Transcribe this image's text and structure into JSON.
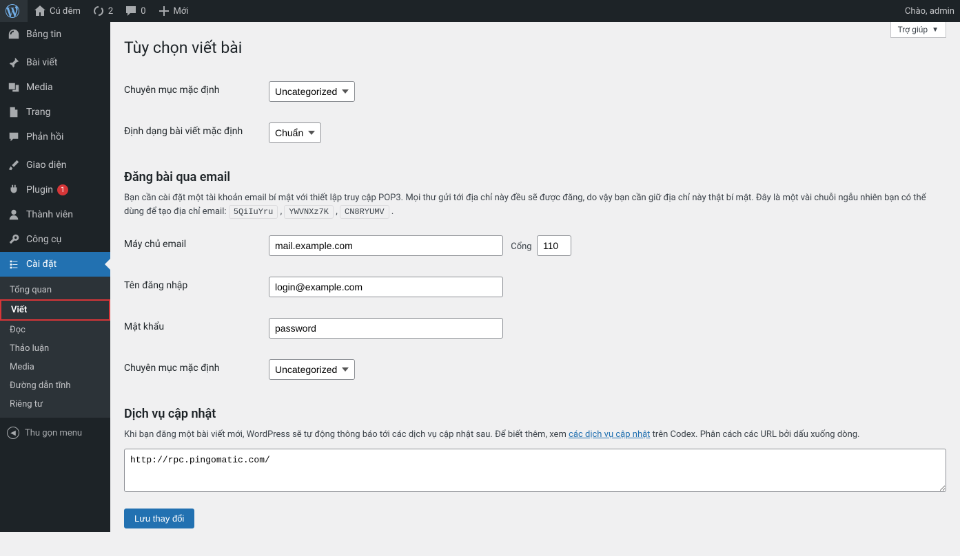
{
  "adminbar": {
    "site_name": "Cú đêm",
    "updates_count": "2",
    "comments_count": "0",
    "new_label": "Mới",
    "greeting": "Chào, admin"
  },
  "sidebar": {
    "items": [
      {
        "label": "Bảng tin",
        "icon": "dashboard"
      },
      {
        "label": "Bài viết",
        "icon": "pin"
      },
      {
        "label": "Media",
        "icon": "media"
      },
      {
        "label": "Trang",
        "icon": "page"
      },
      {
        "label": "Phản hồi",
        "icon": "comment"
      },
      {
        "label": "Giao diện",
        "icon": "brush"
      },
      {
        "label": "Plugin",
        "icon": "plug",
        "badge": "1"
      },
      {
        "label": "Thành viên",
        "icon": "user"
      },
      {
        "label": "Công cụ",
        "icon": "wrench"
      },
      {
        "label": "Cài đặt",
        "icon": "settings",
        "current": true
      }
    ],
    "submenu": [
      {
        "label": "Tổng quan"
      },
      {
        "label": "Viết",
        "current": true
      },
      {
        "label": "Đọc"
      },
      {
        "label": "Thảo luận"
      },
      {
        "label": "Media"
      },
      {
        "label": "Đường dẫn tĩnh"
      },
      {
        "label": "Riêng tư"
      }
    ],
    "collapse_label": "Thu gọn menu"
  },
  "help_tab": "Trợ giúp",
  "page": {
    "title": "Tùy chọn viết bài",
    "default_category_label": "Chuyên mục mặc định",
    "default_category_value": "Uncategorized",
    "default_format_label": "Định dạng bài viết mặc định",
    "default_format_value": "Chuẩn",
    "email_heading": "Đăng bài qua email",
    "email_desc_before": "Bạn cần cài đặt một tài khoản email bí mật với thiết lập truy cập POP3. Mọi thư gửi tới địa chỉ này đều sẽ được đăng, do vậy bạn cần giữ địa chỉ này thật bí mật. Đây là một vài chuỗi ngẫu nhiên bạn có thể dùng để tạo địa chỉ email: ",
    "random_strings": [
      "5QiIuYru",
      "YWVNXz7K",
      "CN8RYUMV"
    ],
    "mail_server_label": "Máy chủ email",
    "mail_server_value": "mail.example.com",
    "port_label": "Cổng",
    "port_value": "110",
    "login_label": "Tên đăng nhập",
    "login_value": "login@example.com",
    "password_label": "Mật khẩu",
    "password_value": "password",
    "email_category_label": "Chuyên mục mặc định",
    "email_category_value": "Uncategorized",
    "update_heading": "Dịch vụ cập nhật",
    "update_desc_before": "Khi bạn đăng một bài viết mới, WordPress sẽ tự động thông báo tới các dịch vụ cập nhật sau. Để biết thêm, xem ",
    "update_link_text": "các dịch vụ cập nhật",
    "update_desc_after": " trên Codex. Phân cách các URL bởi dấu xuống dòng.",
    "ping_sites": "http://rpc.pingomatic.com/",
    "submit_label": "Lưu thay đổi"
  }
}
